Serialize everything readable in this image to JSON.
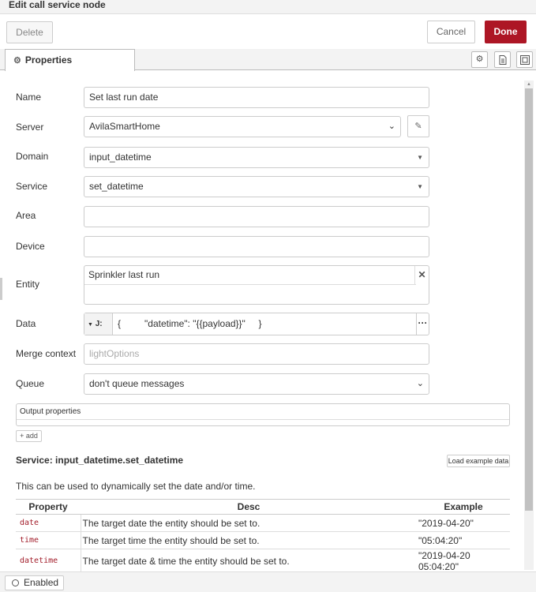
{
  "window": {
    "title": "Edit call service node"
  },
  "toolbar": {
    "delete_label": "Delete",
    "cancel_label": "Cancel",
    "done_label": "Done"
  },
  "tabs": {
    "properties_label": "Properties",
    "gear_icon": "gear-icon",
    "description_icon": "document-icon",
    "appearance_icon": "layout-icon"
  },
  "form": {
    "name": {
      "label": "Name",
      "value": "Set last run date"
    },
    "server": {
      "label": "Server",
      "value": "AvilaSmartHome"
    },
    "domain": {
      "label": "Domain",
      "value": "input_datetime"
    },
    "service": {
      "label": "Service",
      "value": "set_datetime"
    },
    "area": {
      "label": "Area",
      "value": ""
    },
    "device": {
      "label": "Device",
      "value": ""
    },
    "entity": {
      "label": "Entity",
      "value": "Sprinkler last run"
    },
    "data": {
      "label": "Data",
      "type_label": "J:",
      "value": "{         \"datetime\": \"{{payload}}\"     }"
    },
    "merge_context": {
      "label": "Merge context",
      "placeholder": "lightOptions"
    },
    "queue": {
      "label": "Queue",
      "value": "don't queue messages"
    }
  },
  "output_properties": {
    "label": "Output properties",
    "add_label": "add"
  },
  "service_info": {
    "title": "Service: input_datetime.set_datetime",
    "load_example_label": "Load example data",
    "description": "This can be used to dynamically set the date and/or time.",
    "columns": [
      "Property",
      "Desc",
      "Example"
    ],
    "rows": [
      {
        "property": "date",
        "desc": "The target date the entity should be set to.",
        "example": "\"2019-04-20\""
      },
      {
        "property": "time",
        "desc": "The target time the entity should be set to.",
        "example": "\"05:04:20\""
      },
      {
        "property": "datetime",
        "desc": "The target date & time the entity should be set to.",
        "example": "\"2019-04-20 05:04:20\""
      }
    ]
  },
  "footer": {
    "enabled_label": "Enabled"
  }
}
